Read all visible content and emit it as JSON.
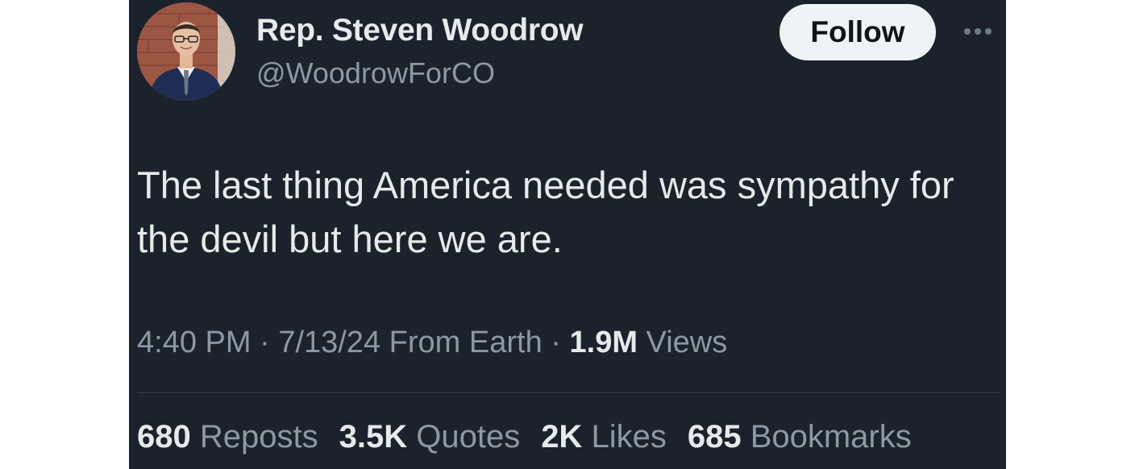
{
  "author": {
    "name": "Rep. Steven Woodrow",
    "handle": "@WoodrowForCO",
    "avatar_icon": "person-photo-avatar"
  },
  "actions": {
    "follow_label": "Follow",
    "more_icon": "more-dots-icon"
  },
  "tweet": {
    "text": "The last thing America needed was sympathy for the devil but here we are."
  },
  "meta": {
    "time": "4:40 PM",
    "sep1": " · ",
    "date": "7/13/24",
    "source": " From Earth",
    "sep2": " · ",
    "views_count": "1.9M",
    "views_label": " Views"
  },
  "stats": [
    {
      "count": "680",
      "label": " Reposts"
    },
    {
      "count": "3.5K",
      "label": " Quotes"
    },
    {
      "count": "2K",
      "label": " Likes"
    },
    {
      "count": "685",
      "label": " Bookmarks"
    }
  ],
  "colors": {
    "background": "#1b222c",
    "primary_text": "#e7e9ea",
    "secondary_text": "#8b98a5",
    "follow_button_bg": "#eff3f4"
  }
}
